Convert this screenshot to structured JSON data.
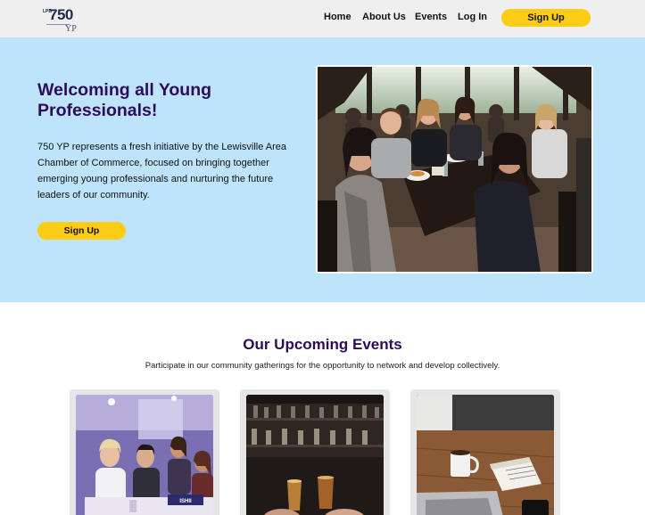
{
  "logo": {
    "tiny": "LPB",
    "number": "750",
    "suffix": "YP"
  },
  "nav": {
    "home": "Home",
    "about": "About Us",
    "events": "Events",
    "login": "Log In",
    "signup": "Sign Up"
  },
  "hero": {
    "title": "Welcoming all Young Professionals!",
    "text": "750 YP represents a fresh initiative by the Lewisville Area Chamber of Commerce, focused on bringing together emerging young professionals and nurturing the future leaders of our community.",
    "signup": "Sign Up",
    "photo": "group-of-young-professionals-at-table-photo"
  },
  "events": {
    "title": "Our Upcoming Events",
    "subtitle": "Participate in our community gatherings for the opportunity to network and develop collectively.",
    "cards": [
      {
        "image": "conference-attendees-photo",
        "badge": "ISHII"
      },
      {
        "image": "bar-toast-photo"
      },
      {
        "image": "laptop-coffee-notebook-photo"
      }
    ]
  },
  "colors": {
    "header_bg": "#efefef",
    "hero_bg": "#bde4fb",
    "accent_yellow": "#fccc16",
    "title_purple": "#2e0c5a"
  }
}
